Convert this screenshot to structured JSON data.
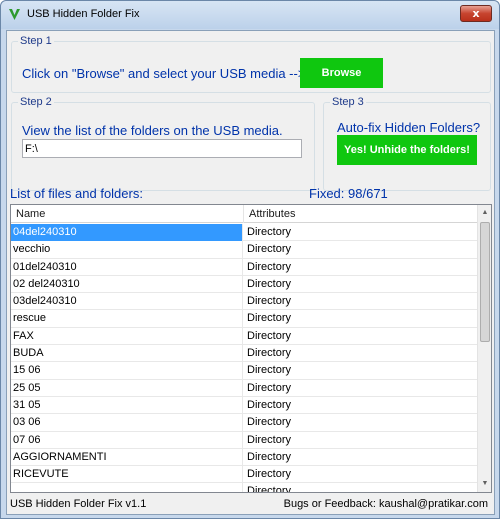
{
  "window": {
    "title": "USB Hidden Folder Fix",
    "close_glyph": "x"
  },
  "step1": {
    "title": "Step 1",
    "instruction": "Click on \"Browse\" and select your USB media -->",
    "browse_label": "Browse"
  },
  "step2": {
    "title": "Step 2",
    "instruction": "View the list of the folders on the USB media.",
    "path_value": "F:\\"
  },
  "step3": {
    "title": "Step 3",
    "question": "Auto-fix Hidden Folders?",
    "unhide_label": "Yes! Unhide the folders!"
  },
  "list": {
    "caption": "List of files and folders:",
    "fixed": "Fixed: 98/671",
    "columns": [
      "Name",
      "Attributes"
    ],
    "rows": [
      [
        "04del240310",
        "Directory"
      ],
      [
        "vecchio",
        "Directory"
      ],
      [
        "01del240310",
        "Directory"
      ],
      [
        "02 del240310",
        "Directory"
      ],
      [
        "03del240310",
        "Directory"
      ],
      [
        "rescue",
        "Directory"
      ],
      [
        "FAX",
        "Directory"
      ],
      [
        "BUDA",
        "Directory"
      ],
      [
        "15 06",
        "Directory"
      ],
      [
        "25 05",
        "Directory"
      ],
      [
        "31 05",
        "Directory"
      ],
      [
        "03 06",
        "Directory"
      ],
      [
        "07 06",
        "Directory"
      ],
      [
        "AGGIORNAMENTI",
        "Directory"
      ],
      [
        "RICEVUTE",
        "Directory"
      ],
      [
        "",
        "Directory"
      ]
    ],
    "selected_index": 0
  },
  "status": {
    "version": "USB Hidden Folder Fix v1.1",
    "feedback": "Bugs or Feedback: kaushal@pratikar.com"
  },
  "colors": {
    "accent_green": "#0fc70f",
    "label_blue": "#0033aa",
    "selection": "#3399ff"
  },
  "icons": {
    "app": "v-logo-icon",
    "close": "close-icon"
  }
}
